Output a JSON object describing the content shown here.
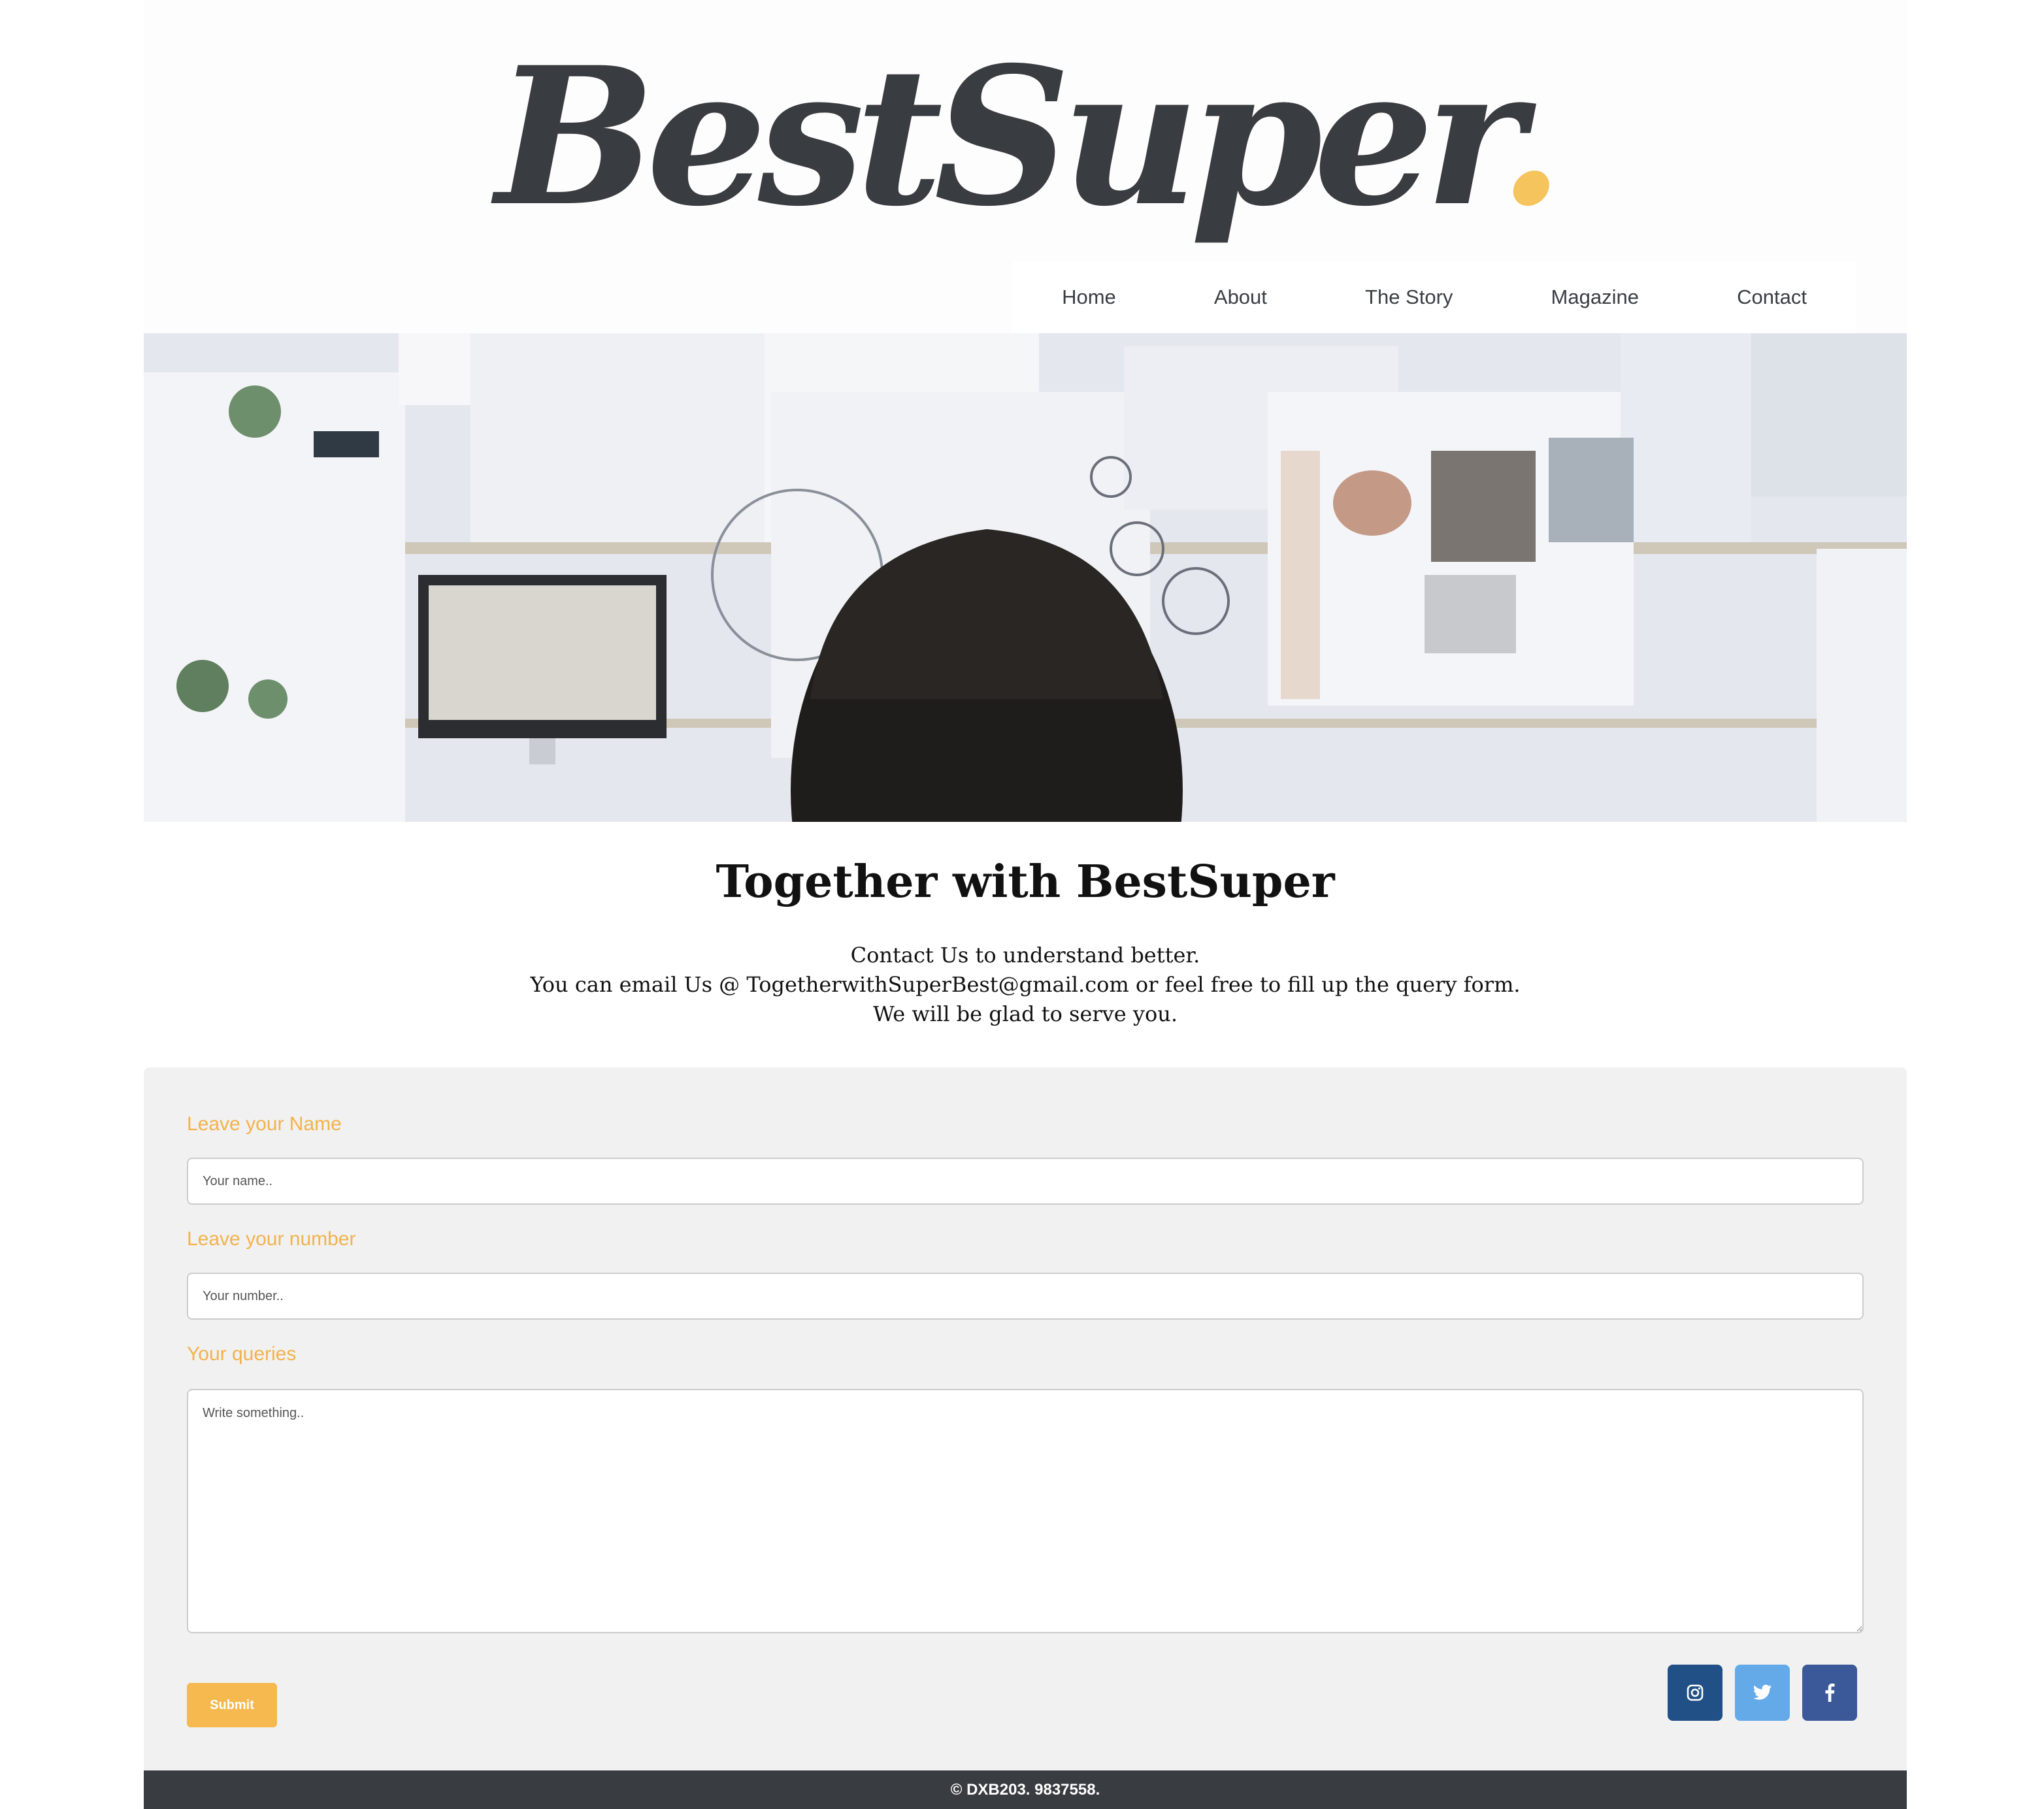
{
  "brand": {
    "name": "BestSuper",
    "dot": ".",
    "dot_color": "#f5c45c",
    "text_color": "#393c40"
  },
  "nav": {
    "items": [
      {
        "label": "Home"
      },
      {
        "label": "About"
      },
      {
        "label": "The Story"
      },
      {
        "label": "Magazine"
      },
      {
        "label": "Contact"
      }
    ]
  },
  "intro": {
    "title": "Together with BestSuper",
    "lines": [
      "Contact Us to understand better.",
      "You can email Us @ TogetherwithSuperBest@gmail.com or feel free to fill up the query form.",
      "We will be glad to serve you."
    ]
  },
  "form": {
    "name_label": "Leave your Name",
    "name_placeholder": "Your name..",
    "number_label": "Leave your number",
    "number_placeholder": "Your number..",
    "queries_label": "Your queries",
    "queries_placeholder": "Write something..",
    "submit_label": "Submit",
    "accent_color": "#f2b24d"
  },
  "social": {
    "links": [
      {
        "icon": "instagram-icon",
        "color": "#215087"
      },
      {
        "icon": "twitter-icon",
        "color": "#64a9e8"
      },
      {
        "icon": "facebook-icon",
        "color": "#3b5998"
      }
    ]
  },
  "footer": {
    "text": "© DXB203. 9837558."
  }
}
